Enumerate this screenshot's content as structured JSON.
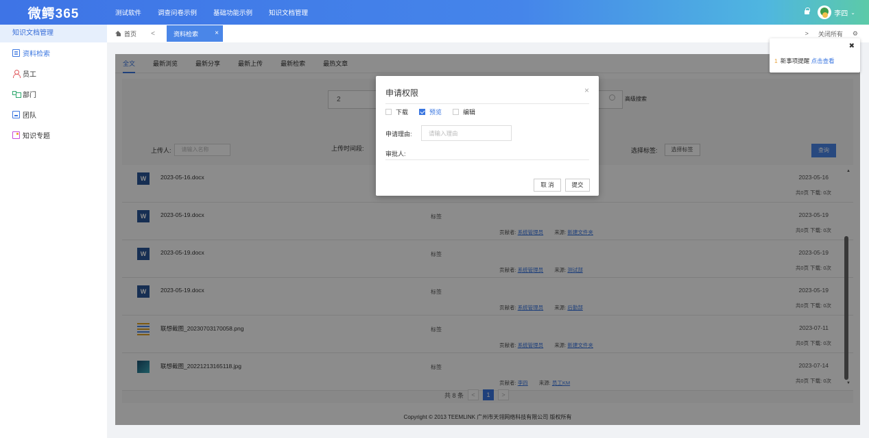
{
  "brand": "微鳄365",
  "topnav": [
    "测试软件",
    "调查问卷示例",
    "基础功能示例",
    "知识文档管理"
  ],
  "user": {
    "name": "李四"
  },
  "sidebar": {
    "title": "知识文档管理",
    "items": [
      {
        "label": "资料检索",
        "icon": "search-doc-icon"
      },
      {
        "label": "员工",
        "icon": "user-icon"
      },
      {
        "label": "部门",
        "icon": "department-icon"
      },
      {
        "label": "团队",
        "icon": "team-icon"
      },
      {
        "label": "知识专题",
        "icon": "topic-icon"
      }
    ]
  },
  "tabs": {
    "home": "首页",
    "active": "资料检索",
    "close_all": "关闭所有"
  },
  "subtabs": [
    "全文",
    "最新浏览",
    "最新分享",
    "最新上传",
    "最新检索",
    "最热文章"
  ],
  "search": {
    "value": "2",
    "advanced": "高级搜索",
    "uploader_label": "上传人:",
    "uploader_placeholder": "请输入名称",
    "upload_time_label": "上传时间段:",
    "tag_label": "选择标签:",
    "tag_button": "选择标签",
    "query_button": "查询"
  },
  "documents": [
    {
      "name": "2023-05-16.docx",
      "type": "word",
      "tag": "",
      "contributor": "",
      "source": "",
      "date": "2023-05-16",
      "stats": "共0页  下载: 0次"
    },
    {
      "name": "2023-05-19.docx",
      "type": "word",
      "tag": "标签",
      "contributor": "系统管理员",
      "source": "新建文件夹",
      "date": "2023-05-19",
      "stats": "共0页  下载: 0次"
    },
    {
      "name": "2023-05-19.docx",
      "type": "word",
      "tag": "标签",
      "contributor": "系统管理员",
      "source": "测试部",
      "date": "2023-05-19",
      "stats": "共0页  下载: 0次"
    },
    {
      "name": "2023-05-19.docx",
      "type": "word",
      "tag": "标签",
      "contributor": "系统管理员",
      "source": "后勤部",
      "date": "2023-05-19",
      "stats": "共0页  下载: 0次"
    },
    {
      "name": "联想截图_20230703170058.png",
      "type": "png",
      "tag": "标签",
      "contributor": "系统管理员",
      "source": "新建文件夹",
      "date": "2023-07-11",
      "stats": "共0页  下载: 0次"
    },
    {
      "name": "联想截图_20221213165118.jpg",
      "type": "jpg",
      "tag": "标签",
      "contributor": "李四",
      "source": "员工KM",
      "date": "2023-07-14",
      "stats": "共0页  下载: 0次"
    }
  ],
  "meta_labels": {
    "contributor": "贡献者:",
    "source": "来源:"
  },
  "pager": {
    "total": "共 8 条",
    "current": "1",
    "prev": "<",
    "next": ">"
  },
  "footer": "Copyright © 2013 TEEMLINK 广州市天翎网络科技有限公司 版权所有",
  "notice": {
    "count": "1",
    "text": "新事项提醒",
    "link": "点击查看"
  },
  "dialog": {
    "title": "申请权限",
    "options": [
      {
        "label": "下载",
        "checked": false
      },
      {
        "label": "预览",
        "checked": true
      },
      {
        "label": "编辑",
        "checked": false
      }
    ],
    "reason_label": "申请理由:",
    "reason_placeholder": "请输入理由",
    "approver_label": "审批人:",
    "cancel": "取 消",
    "submit": "提交"
  },
  "colors": {
    "primary": "#3a76e0",
    "accent_green": "#5ccaa8"
  }
}
